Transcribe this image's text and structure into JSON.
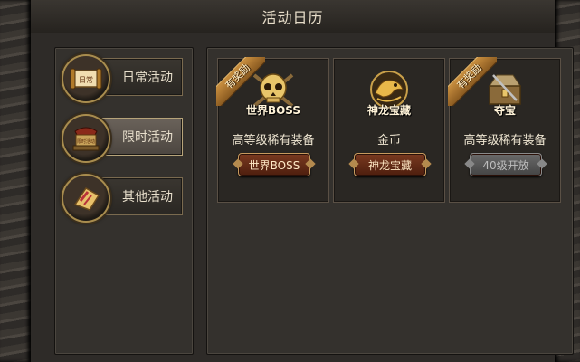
{
  "window": {
    "title": "活动日历"
  },
  "tabs": [
    {
      "label": "日常活动",
      "icon": "calendar-scroll-icon",
      "icon_text": "日常",
      "active": false
    },
    {
      "label": "限时活动",
      "icon": "hourglass-altar-icon",
      "icon_text": "限时活动",
      "active": true
    },
    {
      "label": "其他活动",
      "icon": "flag-scroll-icon",
      "active": false
    }
  ],
  "cards": [
    {
      "name": "世界BOSS",
      "icon": "skull-emblem-icon",
      "ribbon": "有奖励",
      "reward": "高等级稀有装备",
      "button": "世界BOSS",
      "button_enabled": true
    },
    {
      "name": "神龙宝藏",
      "icon": "dragon-emblem-icon",
      "ribbon": "",
      "reward": "金币",
      "button": "神龙宝藏",
      "button_enabled": true
    },
    {
      "name": "夺宝",
      "icon": "treasure-chest-icon",
      "ribbon": "有奖励",
      "reward": "高等级稀有装备",
      "button": "40级开放",
      "button_enabled": false
    }
  ]
}
